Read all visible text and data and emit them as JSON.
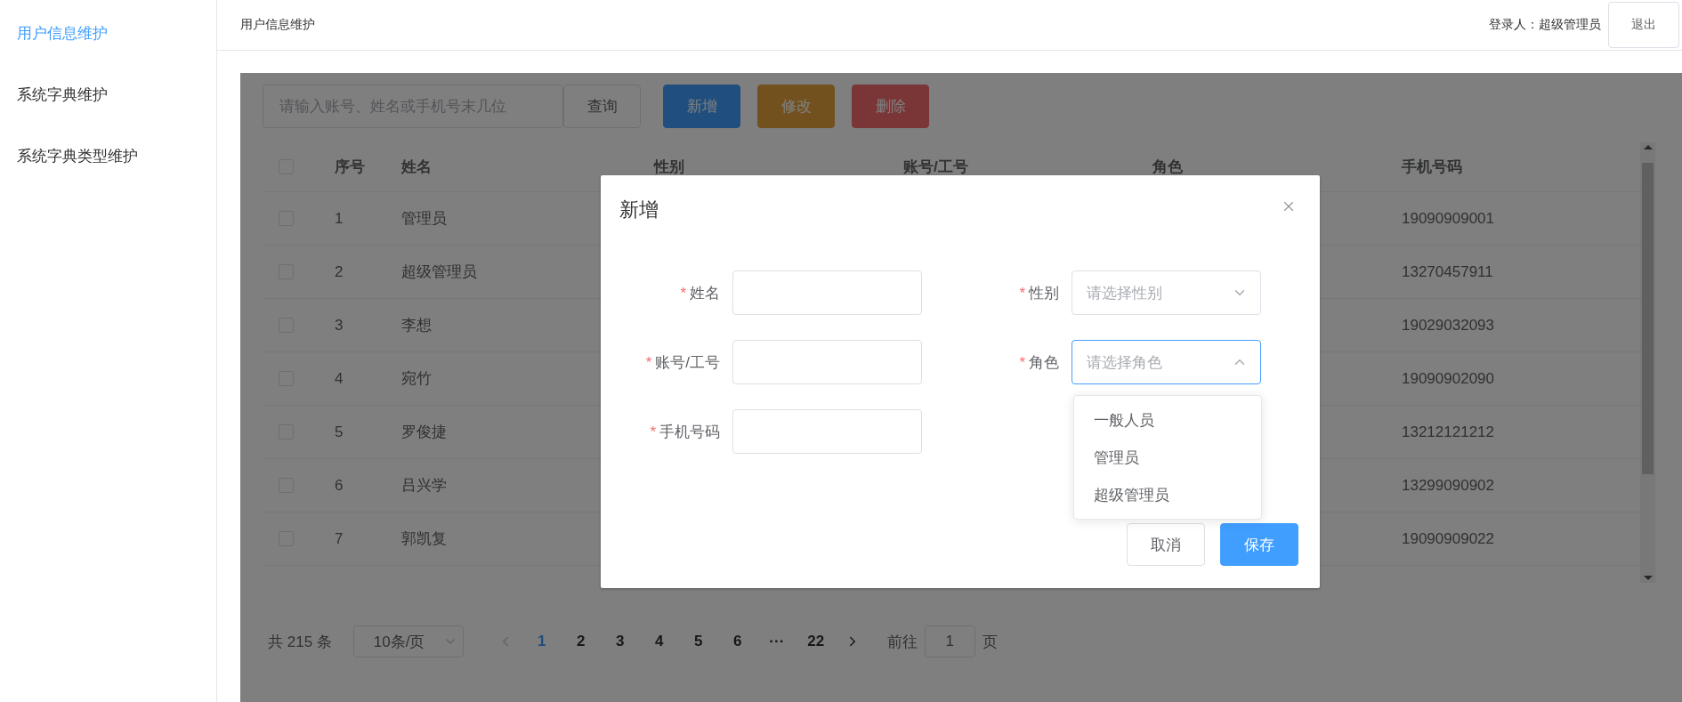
{
  "sidebar": {
    "items": [
      {
        "label": "用户信息维护",
        "selected": true
      },
      {
        "label": "系统字典维护",
        "selected": false
      },
      {
        "label": "系统字典类型维护",
        "selected": false
      }
    ]
  },
  "header": {
    "title": "用户信息维护",
    "user": "登录人：超级管理员",
    "logout": "退出"
  },
  "toolbar": {
    "search_placeholder": "请输入账号、姓名或手机号末几位",
    "buttons": [
      {
        "label": "查询",
        "kind": "plain"
      },
      {
        "label": "新增",
        "kind": "primary"
      },
      {
        "label": "修改",
        "kind": "warning"
      },
      {
        "label": "删除",
        "kind": "danger"
      }
    ]
  },
  "table": {
    "header_checked": false,
    "columns": [
      {
        "label": "序号"
      },
      {
        "label": "姓名"
      },
      {
        "label": "性别"
      },
      {
        "label": "账号/工号"
      },
      {
        "label": "角色"
      },
      {
        "label": "手机号码"
      }
    ],
    "rows": [
      {
        "checked": false,
        "index": "1",
        "name": "管理员",
        "phone": "19090909001"
      },
      {
        "checked": false,
        "index": "2",
        "name": "超级管理员",
        "phone": "13270457911"
      },
      {
        "checked": false,
        "index": "3",
        "name": "李想",
        "phone": "19029032093"
      },
      {
        "checked": false,
        "index": "4",
        "name": "宛竹",
        "phone": "19090902090"
      },
      {
        "checked": false,
        "index": "5",
        "name": "罗俊捷",
        "phone": "13212121212"
      },
      {
        "checked": false,
        "index": "6",
        "name": "吕兴学",
        "phone": "13299090902"
      },
      {
        "checked": false,
        "index": "7",
        "name": "郭凯复",
        "phone": "19090909022"
      }
    ]
  },
  "pagination": {
    "total": "共 215 条",
    "page_size": "10条/页",
    "prev": {
      "disabled": true
    },
    "next": {
      "disabled": false
    },
    "pages": [
      {
        "label": "1",
        "selected": true
      },
      {
        "label": "2",
        "selected": false
      },
      {
        "label": "3",
        "selected": false
      },
      {
        "label": "4",
        "selected": false
      },
      {
        "label": "5",
        "selected": false
      },
      {
        "label": "6",
        "selected": false
      },
      {
        "label": "···",
        "selected": false
      },
      {
        "label": "22",
        "selected": false
      }
    ],
    "goto_label": "前往",
    "goto_value": "1",
    "goto_suffix": "页"
  },
  "dialog": {
    "title": "新增",
    "fields": [
      {
        "label": "姓名",
        "required_mark": "*",
        "kind": "input"
      },
      {
        "label": "性别",
        "required_mark": "*",
        "kind": "select",
        "placeholder": "请选择性别",
        "open": false
      },
      {
        "label": "账号/工号",
        "required_mark": "*",
        "kind": "input"
      },
      {
        "label": "角色",
        "required_mark": "*",
        "kind": "select",
        "placeholder": "请选择角色",
        "open": true
      },
      {
        "label": "手机号码",
        "required_mark": "*",
        "kind": "input"
      }
    ],
    "dropdown_options": [
      {
        "label": "一般人员"
      },
      {
        "label": "管理员"
      },
      {
        "label": "超级管理员"
      }
    ],
    "buttons": [
      {
        "label": "取消",
        "kind": "plain"
      },
      {
        "label": "保存",
        "kind": "primary"
      }
    ]
  }
}
